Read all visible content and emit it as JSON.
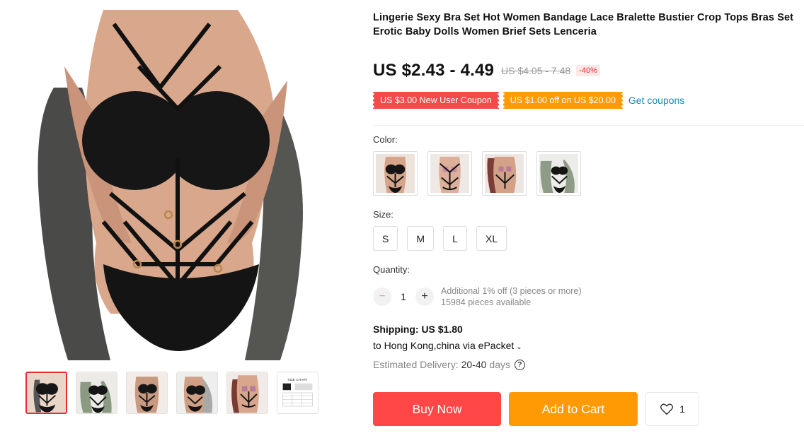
{
  "product": {
    "title": "Lingerie Sexy Bra Set Hot Women Bandage Lace Bralette Bustier Crop Tops Bras Set Erotic Baby Dolls Women Brief Sets Lenceria"
  },
  "price": {
    "current": "US $2.43 - 4.49",
    "original": "US $4.05 - 7.48",
    "discount": "-40%"
  },
  "coupons": {
    "new_user": "US $3.00 New User Coupon",
    "store": "US $1.00 off on US $20.00",
    "get_link": "Get coupons"
  },
  "color": {
    "label": "Color:",
    "swatch_count": 4
  },
  "size": {
    "label": "Size:",
    "options": [
      "S",
      "M",
      "L",
      "XL"
    ]
  },
  "quantity": {
    "label": "Quantity:",
    "value": "1",
    "minus": "−",
    "plus": "+",
    "note_discount": "Additional 1% off (3 pieces or more)",
    "note_available": "15984 pieces available"
  },
  "shipping": {
    "label": "Shipping:",
    "price": "US $1.80",
    "destination": "to Hong Kong,china via ePacket",
    "delivery_label": "Estimated Delivery:",
    "delivery_range": "20-40",
    "delivery_unit": "days",
    "help_glyph": "?"
  },
  "actions": {
    "buy_now": "Buy Now",
    "add_to_cart": "Add to Cart",
    "wishlist_count": "1"
  },
  "gallery": {
    "thumb_count": 6,
    "size_chart_label": "SIZE CHART"
  },
  "colors": {
    "accent_red": "#ff4747",
    "accent_orange": "#ff9a04",
    "coupon_red": "#f34a4a",
    "link_blue": "#1b8ab4"
  },
  "icons": {
    "heart": "heart-icon",
    "chevron": "chevron-down-icon",
    "help": "question-circle-icon"
  }
}
